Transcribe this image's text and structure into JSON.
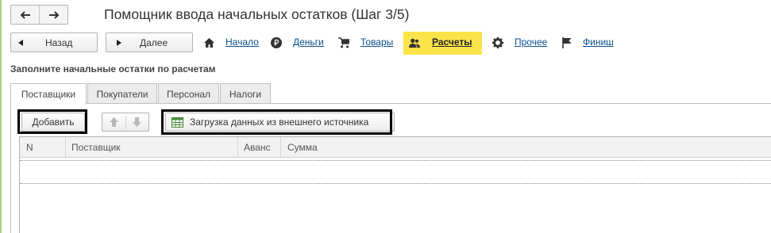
{
  "window": {
    "title": "Помощник ввода начальных остатков (Шаг 3/5)"
  },
  "steps": {
    "back_label": "Назад",
    "next_label": "Далее",
    "items": [
      {
        "label": "Начало",
        "icon": "home-icon"
      },
      {
        "label": "Деньги",
        "icon": "ruble-coin-icon"
      },
      {
        "label": "Товары",
        "icon": "cart-icon"
      },
      {
        "label": "Расчеты",
        "icon": "people-icon",
        "active": true
      },
      {
        "label": "Прочее",
        "icon": "gear-icon"
      },
      {
        "label": "Финиш",
        "icon": "flag-icon"
      }
    ],
    "active_color": "#fbe449"
  },
  "section": {
    "title": "Заполните начальные остатки по расчетам"
  },
  "tabs": [
    {
      "label": "Поставщики",
      "active": true
    },
    {
      "label": "Покупатели"
    },
    {
      "label": "Персонал"
    },
    {
      "label": "Налоги"
    }
  ],
  "toolbar": {
    "add_label": "Добавить",
    "load_label": "Загрузка данных из внешнего источника"
  },
  "table": {
    "columns": [
      "N",
      "Поставщик",
      "Аванс",
      "Сумма"
    ],
    "rows": []
  }
}
